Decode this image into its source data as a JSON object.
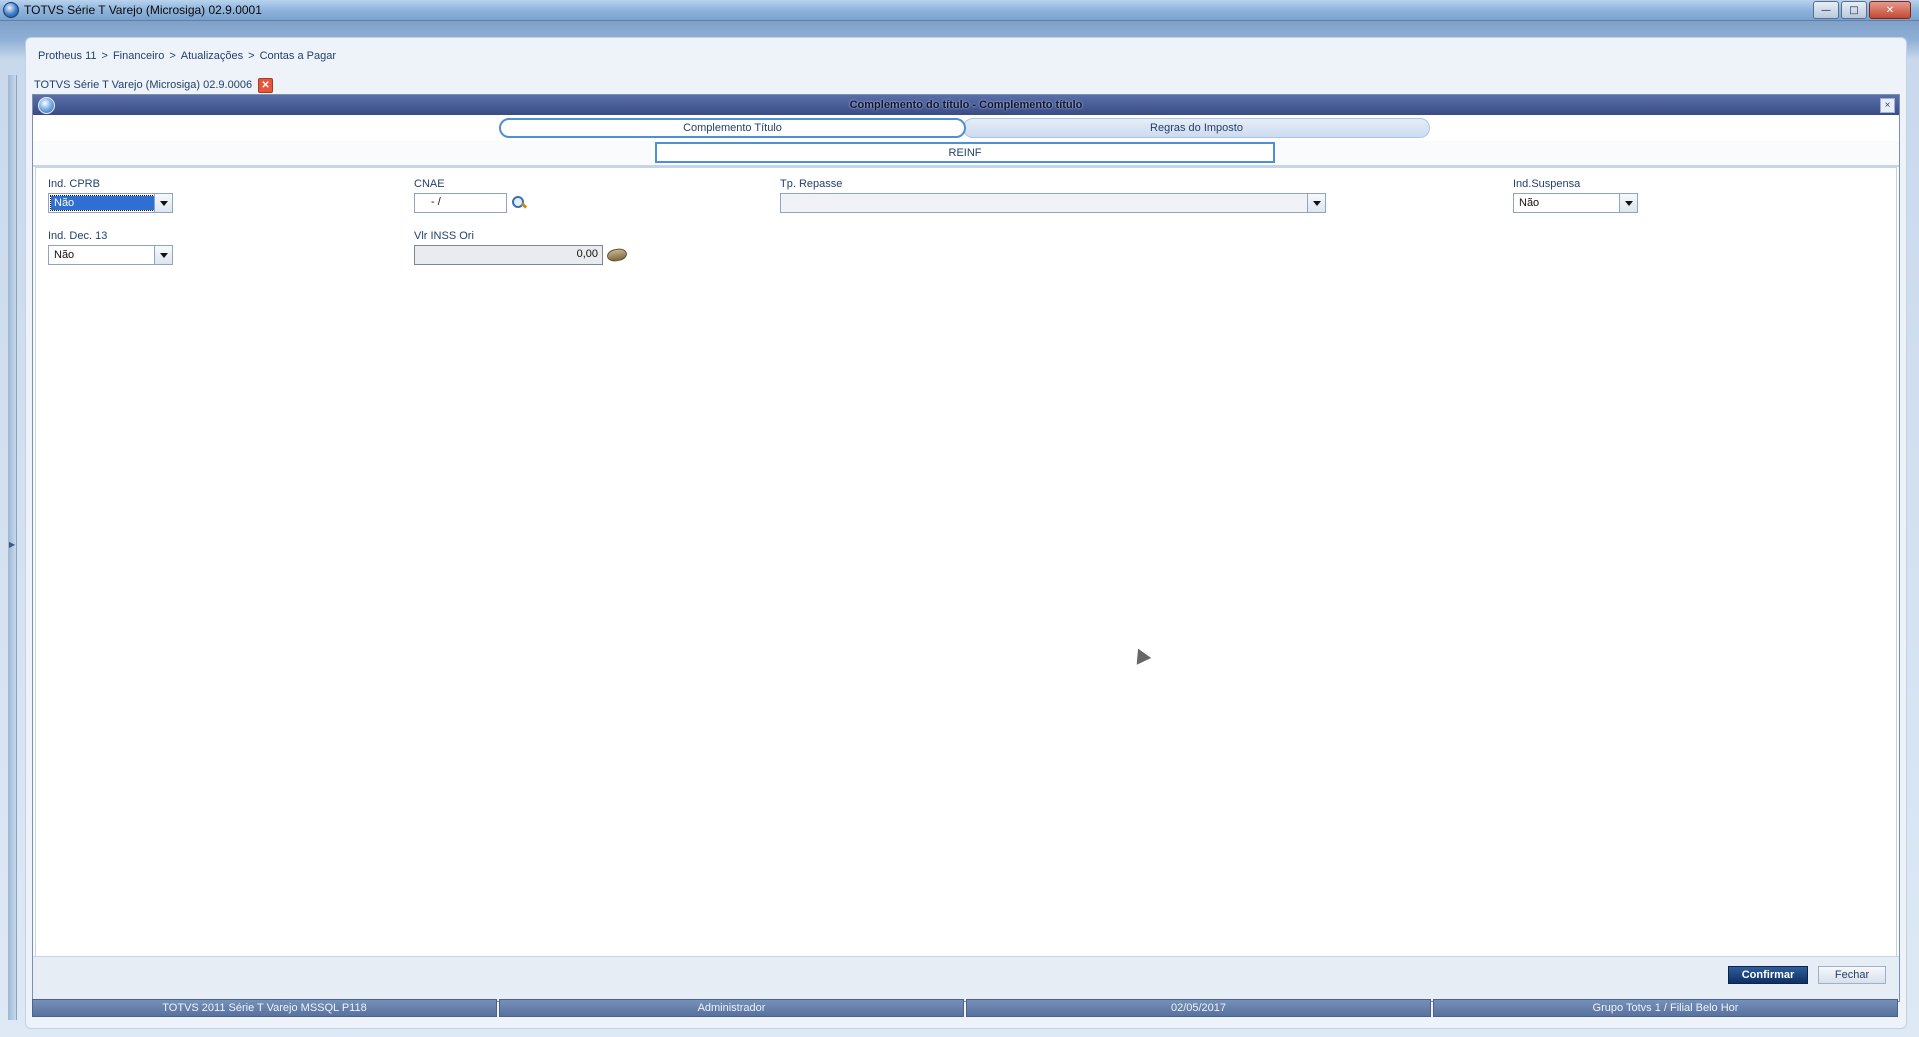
{
  "os_window": {
    "title": "TOTVS Série T Varejo (Microsiga) 02.9.0001",
    "controls": {
      "minimize": "—",
      "maximize": "□",
      "close": "✕"
    }
  },
  "breadcrumb": [
    "Protheus 11",
    ">",
    "Financeiro",
    ">",
    "Atualizações",
    ">",
    "Contas a Pagar"
  ],
  "document_tab": {
    "label": "TOTVS Série T Varejo (Microsiga) 02.9.0006",
    "close": "✕"
  },
  "dialog": {
    "title": "Complemento do título - Complemento título",
    "close": "×",
    "tabs": [
      {
        "label": "Complemento Título",
        "active": true
      },
      {
        "label": "Regras do Imposto",
        "active": false
      }
    ],
    "subtab": {
      "label": "REINF"
    }
  },
  "form": {
    "ind_cprb": {
      "label": "Ind. CPRB",
      "value": "Não"
    },
    "cnae": {
      "label": "CNAE",
      "value": "- /"
    },
    "tp_repasse": {
      "label": "Tp. Repasse",
      "value": ""
    },
    "ind_suspensa": {
      "label": "Ind.Suspensa",
      "value": "Não"
    },
    "ind_dec13": {
      "label": "Ind. Dec. 13",
      "value": "Não"
    },
    "vlr_inss_ori": {
      "label": "Vlr INSS Ori",
      "value": "0,00"
    }
  },
  "buttons": {
    "confirm": "Confirmar",
    "close": "Fechar"
  },
  "status_bar": [
    "TOTVS 2011 Série T Varejo MSSQL P118",
    "Administrador",
    "02/05/2017",
    "Grupo Totvs 1 / Filial Belo Hor"
  ],
  "colors": {
    "dialog_title": "#394c86",
    "confirm_button": "#0e2f62",
    "status_bar": "#58729e",
    "selected_value": "#2f6fd3"
  }
}
